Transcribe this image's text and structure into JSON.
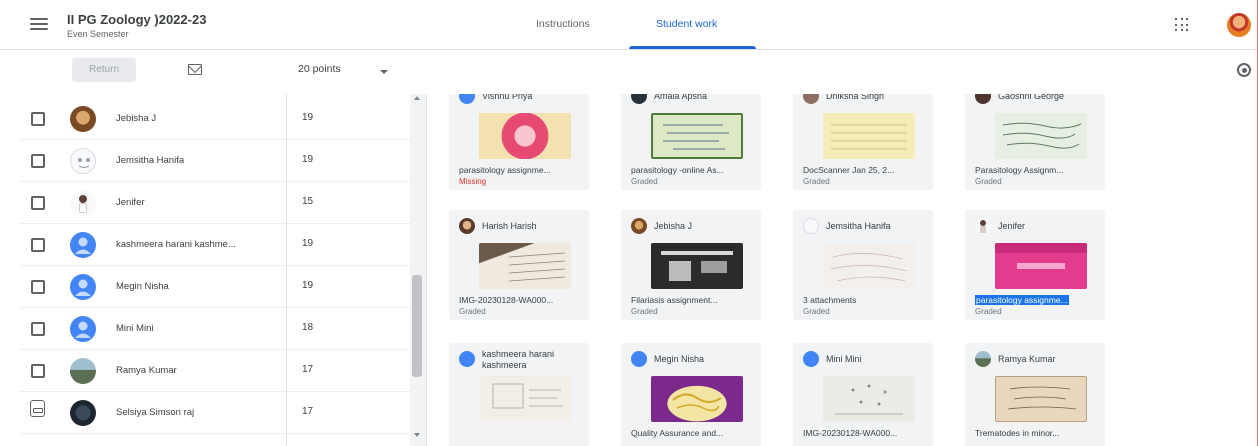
{
  "header": {
    "course_title": "II PG Zoology )2022-23",
    "course_subtitle": "Even Semester",
    "tabs": [
      {
        "label": "Instructions",
        "active": false
      },
      {
        "label": "Student work",
        "active": true
      }
    ],
    "accent_color": "#1967d2"
  },
  "toolbar": {
    "return_label": "Return",
    "points_value": "20 points"
  },
  "students": [
    {
      "name": "Jebisha J",
      "grade": "19",
      "avatar": "photo-avatar-brown"
    },
    {
      "name": "Jemsitha Hanifa",
      "grade": "19",
      "avatar": "cartoon-avatar"
    },
    {
      "name": "Jenifer",
      "grade": "15",
      "avatar": "figure-avatar"
    },
    {
      "name": "kashmeera harani kashme...",
      "grade": "19",
      "avatar": "default-person-avatar"
    },
    {
      "name": "Megin Nisha",
      "grade": "19",
      "avatar": "default-person-avatar"
    },
    {
      "name": "Mini Mini",
      "grade": "18",
      "avatar": "default-person-avatar"
    },
    {
      "name": "Ramya Kumar",
      "grade": "17",
      "avatar": "landscape-avatar"
    },
    {
      "name": "Selsiya Simson raj",
      "grade": "17",
      "avatar": "dark-avatar"
    }
  ],
  "submissions": [
    {
      "name": "Vishnu Priya",
      "file": "parasitology assignme...",
      "status": "Missing",
      "thumb": "pink-circle-thumb"
    },
    {
      "name": "Amala Apsha",
      "file": "parasitology -online As...",
      "status": "Graded",
      "thumb": "green-notes-thumb"
    },
    {
      "name": "Dhiksha Singh",
      "file": "DocScanner Jan 25, 2...",
      "status": "Graded",
      "thumb": "yellow-paper-thumb"
    },
    {
      "name": "Gaoshni George",
      "file": "Parasitology Assignm...",
      "status": "Graded",
      "thumb": "handwritten-notes-thumb"
    },
    {
      "name": "Harish Harish",
      "file": "IMG-20230128-WA000...",
      "status": "Graded",
      "thumb": "handwriting-photo-thumb"
    },
    {
      "name": "Jebisha J",
      "file": "Filariasis assignment...",
      "status": "Graded",
      "thumb": "dark-diagram-thumb"
    },
    {
      "name": "Jemsitha Hanifa",
      "file": "3 attachments",
      "status": "Graded",
      "thumb": "white-page-thumb"
    },
    {
      "name": "Jenifer",
      "file": "parasitology assignme...",
      "status": "Graded",
      "thumb": "pink-title-thumb",
      "selected": true
    },
    {
      "name": "kashmeera harani kashmeera",
      "file": "",
      "status": "",
      "thumb": "sketch-paper-thumb"
    },
    {
      "name": "Megin Nisha",
      "file": "Quality Assurance and...",
      "status": "",
      "thumb": "purple-cover-thumb"
    },
    {
      "name": "Mini Mini",
      "file": "IMG-20230128-WA000...",
      "status": "",
      "thumb": "diagram-page-thumb"
    },
    {
      "name": "Ramya Kumar",
      "file": "Trematodes in minor...",
      "status": "",
      "thumb": "beige-page-thumb"
    }
  ],
  "colors": {
    "missing": "#d93025",
    "selection": "#1a73e8"
  }
}
